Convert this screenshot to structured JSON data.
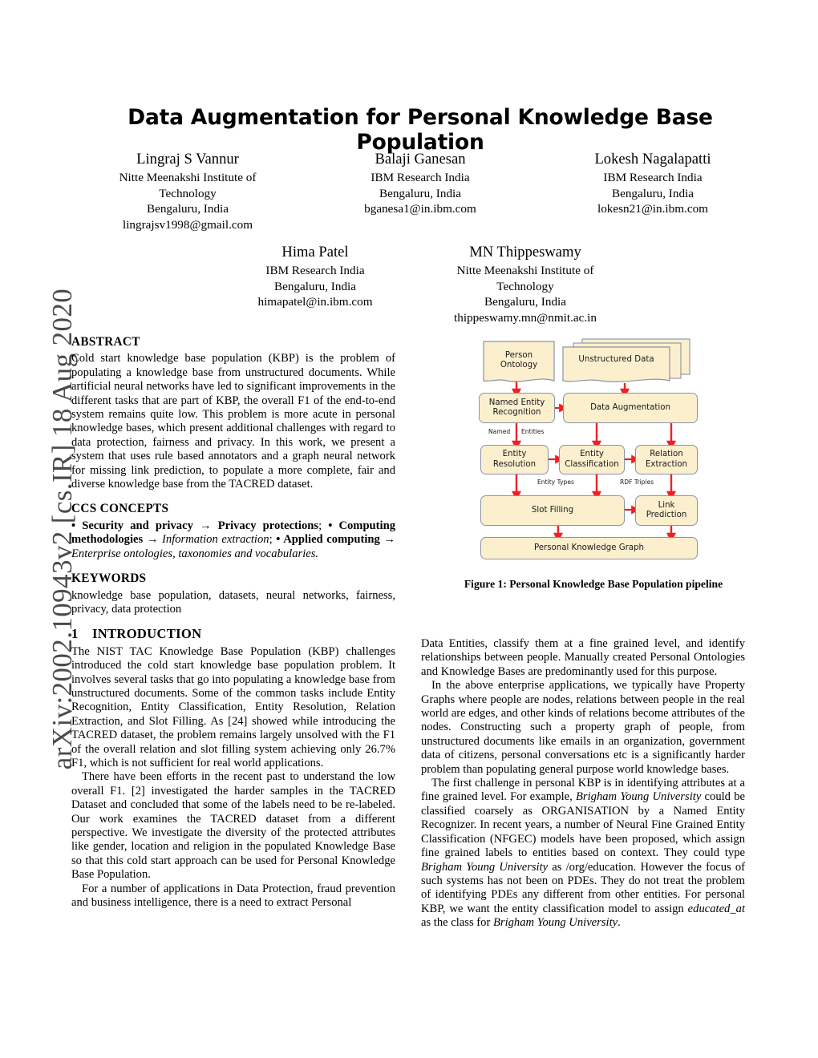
{
  "arxiv_stamp": "arXiv:2002.10943v2  [cs.IR]  18 Aug 2020",
  "paper": {
    "title": "Data Augmentation for Personal Knowledge Base Population",
    "authors_row1": [
      {
        "name": "Lingraj S Vannur",
        "lines": [
          "Nitte Meenakshi Institute of",
          "Technology",
          "Bengaluru, India",
          "lingrajsv1998@gmail.com"
        ]
      },
      {
        "name": "Balaji Ganesan",
        "lines": [
          "IBM Research India",
          "Bengaluru, India",
          "bganesa1@in.ibm.com"
        ]
      },
      {
        "name": "Lokesh Nagalapatti",
        "lines": [
          "IBM Research India",
          "Bengaluru, India",
          "lokesn21@in.ibm.com"
        ]
      }
    ],
    "authors_row2": [
      {
        "name": "Hima Patel",
        "lines": [
          "IBM Research India",
          "Bengaluru, India",
          "himapatel@in.ibm.com"
        ]
      },
      {
        "name": "MN Thippeswamy",
        "lines": [
          "Nitte Meenakshi Institute of",
          "Technology",
          "Bengaluru, India",
          "thippeswamy.mn@nmit.ac.in"
        ]
      }
    ]
  },
  "abstract": {
    "heading": "ABSTRACT",
    "text": "Cold start knowledge base population (KBP) is the problem of populating a knowledge base from unstructured documents. While artificial neural networks have led to significant improvements in the different tasks that are part of KBP, the overall F1 of the end-to-end system remains quite low. This problem is more acute in personal knowledge bases, which present additional challenges with regard to data protection, fairness and privacy. In this work, we present a system that uses rule based annotators and a graph neural network for missing link prediction, to populate a more complete, fair and diverse knowledge base from the TACRED dataset."
  },
  "ccs": {
    "heading": "CCS CONCEPTS",
    "part1_bold": "• Security and privacy",
    "arrow1": " → ",
    "part2_bold": "Privacy protections",
    "sep1": "; ",
    "part3_bold": "• Computing methodologies",
    "arrow2": " → ",
    "part4_italic": "Information extraction",
    "sep2": "; ",
    "part5_bold": "• Applied computing",
    "arrow3": " → ",
    "part6_italic": "Enterprise ontologies, taxonomies and vocabularies."
  },
  "keywords": {
    "heading": "KEYWORDS",
    "text": "knowledge base population, datasets, neural networks, fairness, privacy, data protection"
  },
  "introduction": {
    "number": "1",
    "heading": "INTRODUCTION",
    "paragraphs": [
      "The NIST TAC Knowledge Base Population (KBP) challenges introduced the cold start knowledge base population problem. It involves several tasks that go into populating a knowledge base from unstructured documents. Some of the common tasks include Entity Recognition, Entity Classification, Entity Resolution, Relation Extraction, and Slot Filling. As [24] showed while introducing the TACRED dataset, the problem remains largely unsolved with the F1 of the overall relation and slot filling system achieving only 26.7% F1, which is not sufficient for real world applications.",
      "There have been efforts in the recent past to understand the low overall F1. [2] investigated the harder samples in the TACRED Dataset and concluded that some of the labels need to be re-labeled. Our work examines the TACRED dataset from a different perspective. We investigate the diversity of the protected attributes like gender, location and religion in the populated Knowledge Base so that this cold start approach can be used for Personal Knowledge Base Population.",
      "For a number of applications in Data Protection, fraud prevention and business intelligence, there is a need to extract Personal"
    ]
  },
  "right_column": {
    "paragraph_continued": "Data Entities, classify them at a fine grained level, and identify relationships between people. Manually created Personal Ontologies and Knowledge Bases are predominantly used for this purpose.",
    "paragraph_2": "In the above enterprise applications, we typically have Property Graphs where people are nodes, relations between people in the real world are edges, and other kinds of relations become attributes of the nodes. Constructing such a property graph of people, from unstructured documents like emails in an organization, government data of citizens, personal conversations etc is a significantly harder problem than populating general purpose world knowledge bases.",
    "paragraph_3_a": "The first challenge in personal KBP is in identifying attributes at a fine grained level. For example, ",
    "paragraph_3_i1": "Brigham Young University",
    "paragraph_3_b": " could be classified coarsely as ORGANISATION by a Named Entity Recognizer. In recent years, a number of Neural Fine Grained Entity Classification (NFGEC) models have been proposed, which assign fine grained labels to entities based on context. They could type ",
    "paragraph_3_i2": "Brigham Young University",
    "paragraph_3_c": " as /org/education. However the focus of such systems has not been on PDEs. They do not treat the problem of identifying PDEs any different from other entities. For personal KBP, we want the entity classification model to assign ",
    "paragraph_3_i3": "educated_at",
    "paragraph_3_d": " as the class for ",
    "paragraph_3_i4": "Brigham Young University",
    "paragraph_3_e": "."
  },
  "figure": {
    "caption": "Figure 1: Personal Knowledge Base Population pipeline",
    "colors": {
      "node_fill": "#FBEFCE",
      "node_border": "#8a93a6",
      "arrow": "#ED2024"
    },
    "nodes": {
      "person_ontology": "Person\nOntology",
      "person_ontology_l1": "Person",
      "person_ontology_l2": "Ontology",
      "unstructured_data": "Unstructured Data",
      "named_entity_recognition_l1": "Named Entity",
      "named_entity_recognition_l2": "Recognition",
      "data_augmentation": "Data Augmentation",
      "entity_resolution_l1": "Entity",
      "entity_resolution_l2": "Resolution",
      "entity_classification_l1": "Entity",
      "entity_classification_l2": "Classification",
      "relation_extraction_l1": "Relation",
      "relation_extraction_l2": "Extraction",
      "slot_filling": "Slot Filling",
      "link_prediction_l1": "Link",
      "link_prediction_l2": "Prediction",
      "personal_knowledge_graph": "Personal Knowledge Graph"
    },
    "edge_labels": {
      "named": "Named",
      "entities": "Entities",
      "entity_types": "Entity Types",
      "rdf_triples": "RDF Triples"
    }
  }
}
